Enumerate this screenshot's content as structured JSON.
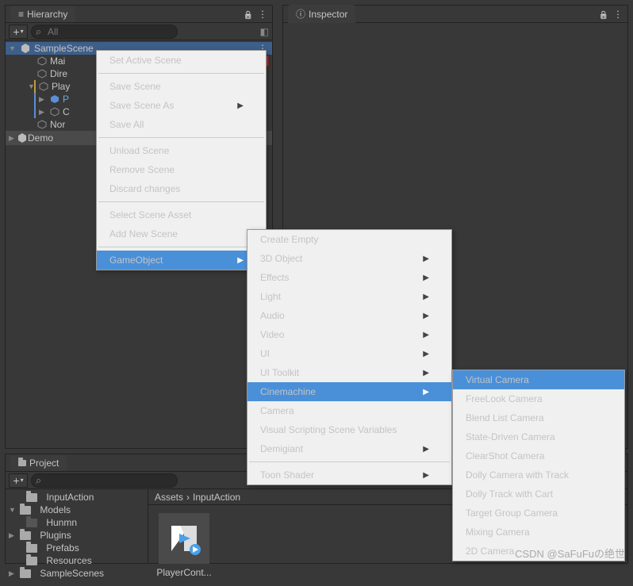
{
  "hierarchy": {
    "title": "Hierarchy",
    "search_placeholder": "All",
    "scene": "SampleScene",
    "items": [
      "Mai",
      "Dire",
      "Play",
      "P",
      "C",
      "Nor",
      "Demo"
    ]
  },
  "inspector": {
    "title": "Inspector"
  },
  "project": {
    "title": "Project",
    "search_placeholder": "",
    "tree": [
      "InputAction",
      "Models",
      "Hunmn",
      "Plugins",
      "Prefabs",
      "Resources",
      "SampleScenes"
    ],
    "breadcrumb": [
      "Assets",
      "InputAction"
    ],
    "asset_name": "PlayerCont..."
  },
  "menu1": {
    "items": [
      "Set Active Scene",
      "Save Scene",
      "Save Scene As",
      "Save All",
      "Unload Scene",
      "Remove Scene",
      "Discard changes",
      "Select Scene Asset",
      "Add New Scene",
      "GameObject"
    ]
  },
  "menu2": {
    "items": [
      "Create Empty",
      "3D Object",
      "Effects",
      "Light",
      "Audio",
      "Video",
      "UI",
      "UI Toolkit",
      "Cinemachine",
      "Camera",
      "Visual Scripting Scene Variables",
      "Demigiant",
      "Toon Shader"
    ]
  },
  "menu3": {
    "items": [
      "Virtual Camera",
      "FreeLook Camera",
      "Blend List Camera",
      "State-Driven Camera",
      "ClearShot Camera",
      "Dolly Camera with Track",
      "Dolly Track with Cart",
      "Target Group Camera",
      "Mixing Camera",
      "2D Camera"
    ]
  },
  "watermark": "CSDN @SaFuFuの绝世"
}
